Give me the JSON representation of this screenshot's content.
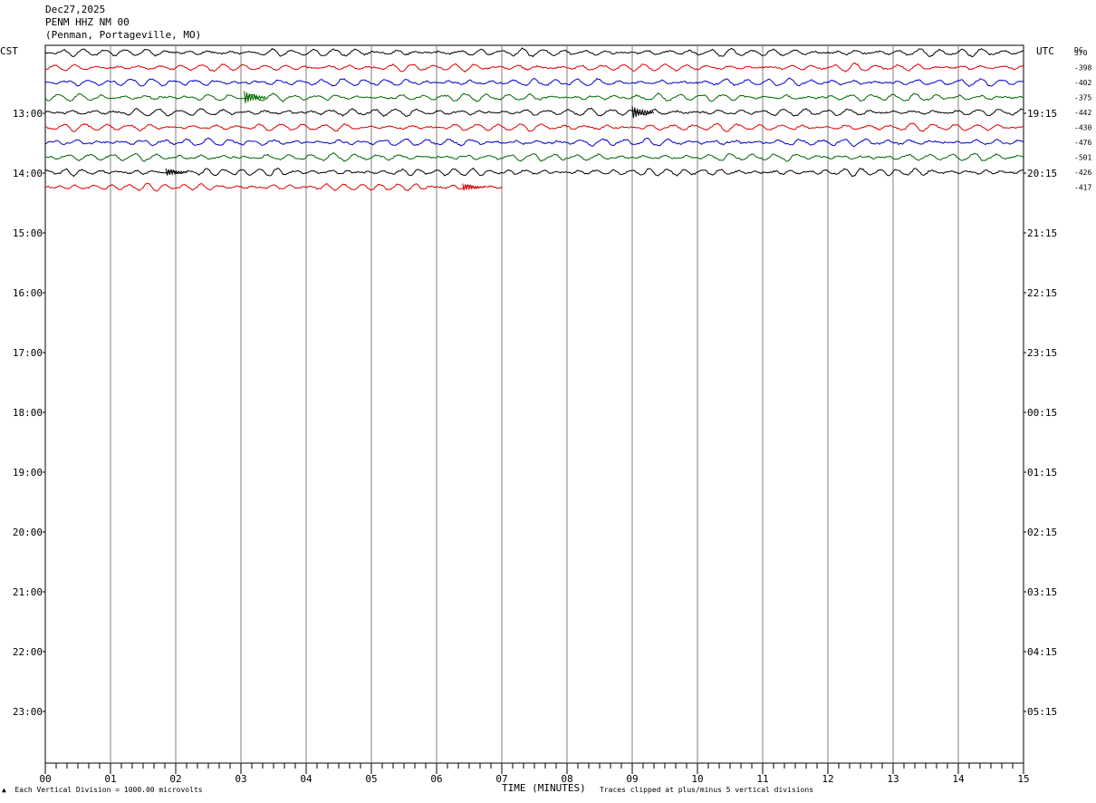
{
  "header": {
    "date": "Dec27,2025",
    "station": "PENM HHZ NM 00",
    "location": "(Penman, Portageville, MO)"
  },
  "left_axis_title": "CST",
  "right_axis_title": "UTC",
  "dc_label": "DC",
  "footer": {
    "scale_mark": "▲",
    "scale_note": "Each Vertical Division = 1000.00 microvolts",
    "xlabel": "TIME (MINUTES)",
    "clip_note": "Traces clipped at plus/minus 5 vertical divisions"
  },
  "chart_data": {
    "type": "line",
    "title": "PENM HHZ NM 00",
    "xlabel": "TIME (MINUTES)",
    "xlim": [
      0,
      15
    ],
    "x_ticks": [
      "00",
      "01",
      "02",
      "03",
      "04",
      "05",
      "06",
      "07",
      "08",
      "09",
      "10",
      "11",
      "12",
      "13",
      "14",
      "15"
    ],
    "local_time_labels": [
      "13:00",
      "14:00",
      "15:00",
      "16:00",
      "17:00",
      "18:00",
      "19:00",
      "20:00",
      "21:00",
      "22:00",
      "23:00"
    ],
    "utc_time_labels": [
      "19:15",
      "20:15",
      "21:15",
      "22:15",
      "23:15",
      "00:15",
      "01:15",
      "02:15",
      "03:15",
      "04:15",
      "05:15"
    ],
    "colors": [
      "#000000",
      "#dd0000",
      "#0000cc",
      "#006600"
    ],
    "traces": [
      {
        "dc": "370",
        "color": "#000000",
        "end_minute": 15
      },
      {
        "dc": "-398",
        "color": "#dd0000",
        "end_minute": 15
      },
      {
        "dc": "-402",
        "color": "#0000cc",
        "end_minute": 15
      },
      {
        "dc": "-375",
        "color": "#006600",
        "end_minute": 15
      },
      {
        "dc": "-442",
        "color": "#000000",
        "end_minute": 15
      },
      {
        "dc": "-430",
        "color": "#dd0000",
        "end_minute": 15
      },
      {
        "dc": "-476",
        "color": "#0000cc",
        "end_minute": 15
      },
      {
        "dc": "-501",
        "color": "#006600",
        "end_minute": 15
      },
      {
        "dc": "-426",
        "color": "#000000",
        "end_minute": 15
      },
      {
        "dc": "-417",
        "color": "#dd0000",
        "end_minute": 7
      }
    ]
  }
}
